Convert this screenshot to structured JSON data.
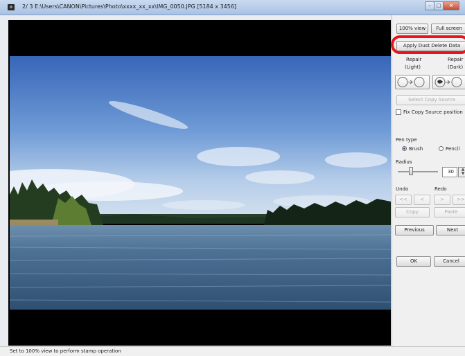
{
  "window": {
    "title": "2/ 3  E:\\Users\\CANON\\Pictures\\Photo\\xxxx_xx_xx\\IMG_0050.JPG [5184 x 3456]"
  },
  "sidebar": {
    "view100_label": "100% view",
    "fullscreen_label": "Full screen",
    "apply_dust_label": "Apply Dust Delete Data",
    "repair_light_label": "Repair",
    "repair_light_sub": "(Light)",
    "repair_dark_label": "Repair",
    "repair_dark_sub": "(Dark)",
    "select_copy_source_label": "Select Copy Source",
    "fix_copy_source_label": "Fix Copy Source position",
    "pen_type_label": "Pen type",
    "brush_label": "Brush",
    "pencil_label": "Pencil",
    "radius_label": "Radius",
    "radius_value": "30",
    "undo_label": "Undo",
    "redo_label": "Redo",
    "undo_all_label": "<<",
    "undo_one_label": "<",
    "redo_one_label": ">",
    "redo_all_label": ">>",
    "copy_label": "Copy",
    "paste_label": "Paste",
    "previous_label": "Previous",
    "next_label": "Next",
    "ok_label": "OK",
    "cancel_label": "Cancel"
  },
  "status": {
    "text": "Set to 100% view to perform stamp operation"
  },
  "colors": {
    "highlight": "#e8141b",
    "sky_top": "#3f6fbf",
    "water": "#3d5f83"
  },
  "icons": [
    "app-icon",
    "minimize-icon",
    "maximize-icon",
    "close-icon",
    "repair-light-icon",
    "repair-dark-icon",
    "slider-thumb-icon"
  ]
}
